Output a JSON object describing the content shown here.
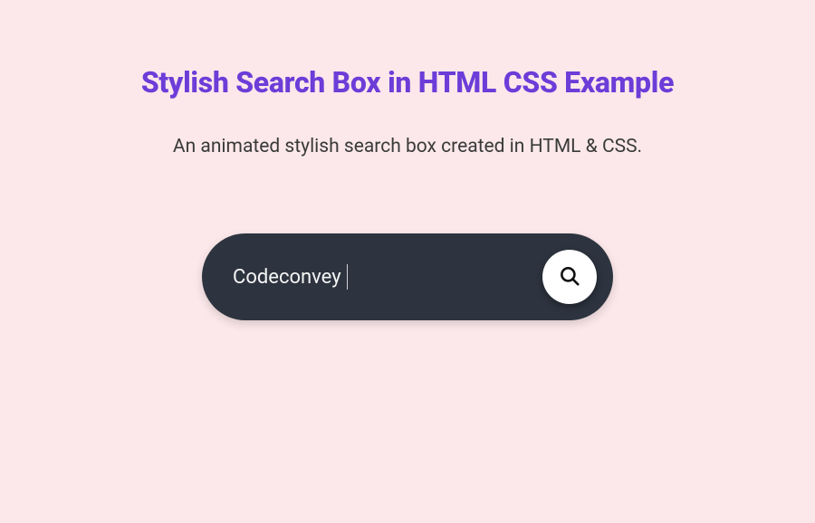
{
  "heading": "Stylish Search Box in HTML CSS Example",
  "subtitle": "An animated stylish search box created in HTML & CSS.",
  "search": {
    "value": "Codeconvey",
    "placeholder": ""
  },
  "icons": {
    "search": "search-icon"
  },
  "colors": {
    "background": "#fce8ea",
    "heading": "#6c3dd8",
    "subtitle": "#3a3a3a",
    "pill": "#2d343f",
    "button": "#ffffff",
    "icon": "#111111"
  }
}
